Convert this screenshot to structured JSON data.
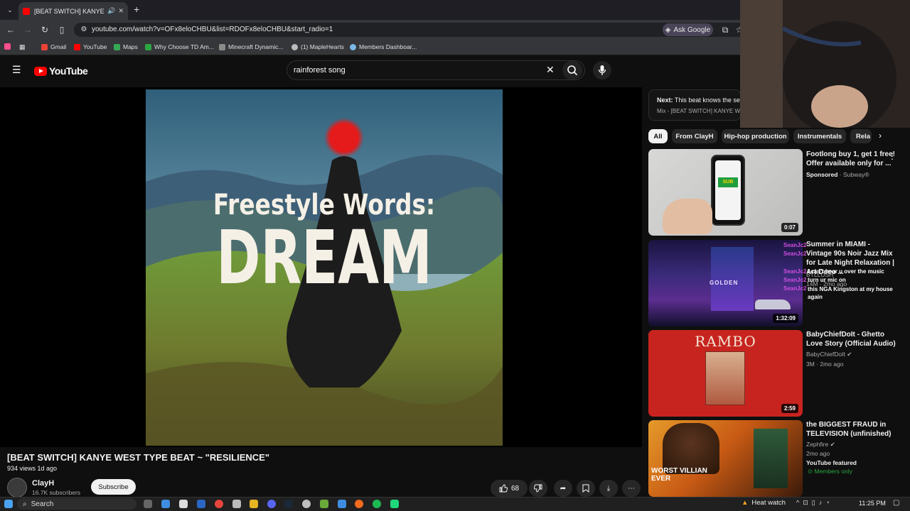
{
  "browser": {
    "tab_title": "[BEAT SWITCH] KANYE WE...",
    "url": "youtube.com/watch?v=OFx8eloCHBU&list=RDOFx8eloCHBU&start_radio=1",
    "ask_google": "Ask Google",
    "bookmarks": [
      "Gmail",
      "YouTube",
      "Maps",
      "Why Choose TD Am...",
      "Minecraft Dynamic...",
      "(1) MapleHearts",
      "Members Dashboar..."
    ]
  },
  "youtube": {
    "logo_text": "YouTube",
    "search_query": "rainforest song"
  },
  "player": {
    "art_line1": "Freestyle Words:",
    "art_line2": "DREAM"
  },
  "video": {
    "title": "[BEAT SWITCH] KANYE WEST TYPE BEAT ~ \"RESILIENCE\"",
    "meta": "934 views  1d ago",
    "channel": "ClayH",
    "subscribers": "16.7K subscribers",
    "subscribe_label": "Subscribe",
    "likes": "68"
  },
  "sidebar": {
    "next_label": "Next:",
    "next_title": "This beat knows the se",
    "next_sub": "Mix - [BEAT SWITCH] KANYE WES",
    "chips": [
      "All",
      "From ClayH",
      "Hip-hop production",
      "Instrumentals",
      "Rela"
    ],
    "items": [
      {
        "title": "Footlong buy 1, get 1 free! Offer available only for ...",
        "sub1": "Sponsored",
        "sub2": " · Subway®",
        "duration": "0:07",
        "thumb_text": "SUB"
      },
      {
        "title": "Summer in MIAMI - Vintage 90s Noir Jazz Mix for Late Night Relaxation | Art Deco ...",
        "sub1": "BTLLUSH",
        "sub2": "14M · 2mo ago",
        "duration": "1:32:09",
        "thumb_text": "GOLDEN"
      },
      {
        "title": "BabyChiefDoIt - Ghetto Love Story (Official Audio)",
        "sub1": "BabyChiefDoIt",
        "sub2": "3M · 2mo ago",
        "duration": "2:59",
        "thumb_text": "RAMBO"
      },
      {
        "title": "the BIGGEST FRAUD in TELEVISION (unfinished)",
        "sub1": "Zephfire",
        "sub2": "2mo ago",
        "extra": "YouTube featured",
        "badge": "Members only",
        "thumb_text": "WORST VILLIAN EVER"
      }
    ],
    "chat": [
      {
        "user": "SeanJc2",
        "msg": ""
      },
      {
        "user": "SeanJc2",
        "msg": ""
      },
      {
        "user": "SeanJc2",
        "msg": "I can't hear u over the music"
      },
      {
        "user": "SeanJc2",
        "msg": "turn ur mic on"
      },
      {
        "user": "SeanJc2",
        "msg": "this NGA Kingston at my house again"
      }
    ]
  },
  "taskbar": {
    "search": "Search",
    "weather": "Heat watch",
    "time": "11:25 PM"
  },
  "colors": {
    "accent": "#ff0000",
    "bg": "#0f0f0f",
    "chat_user": "#d04ee0",
    "members": "#2ba640"
  }
}
